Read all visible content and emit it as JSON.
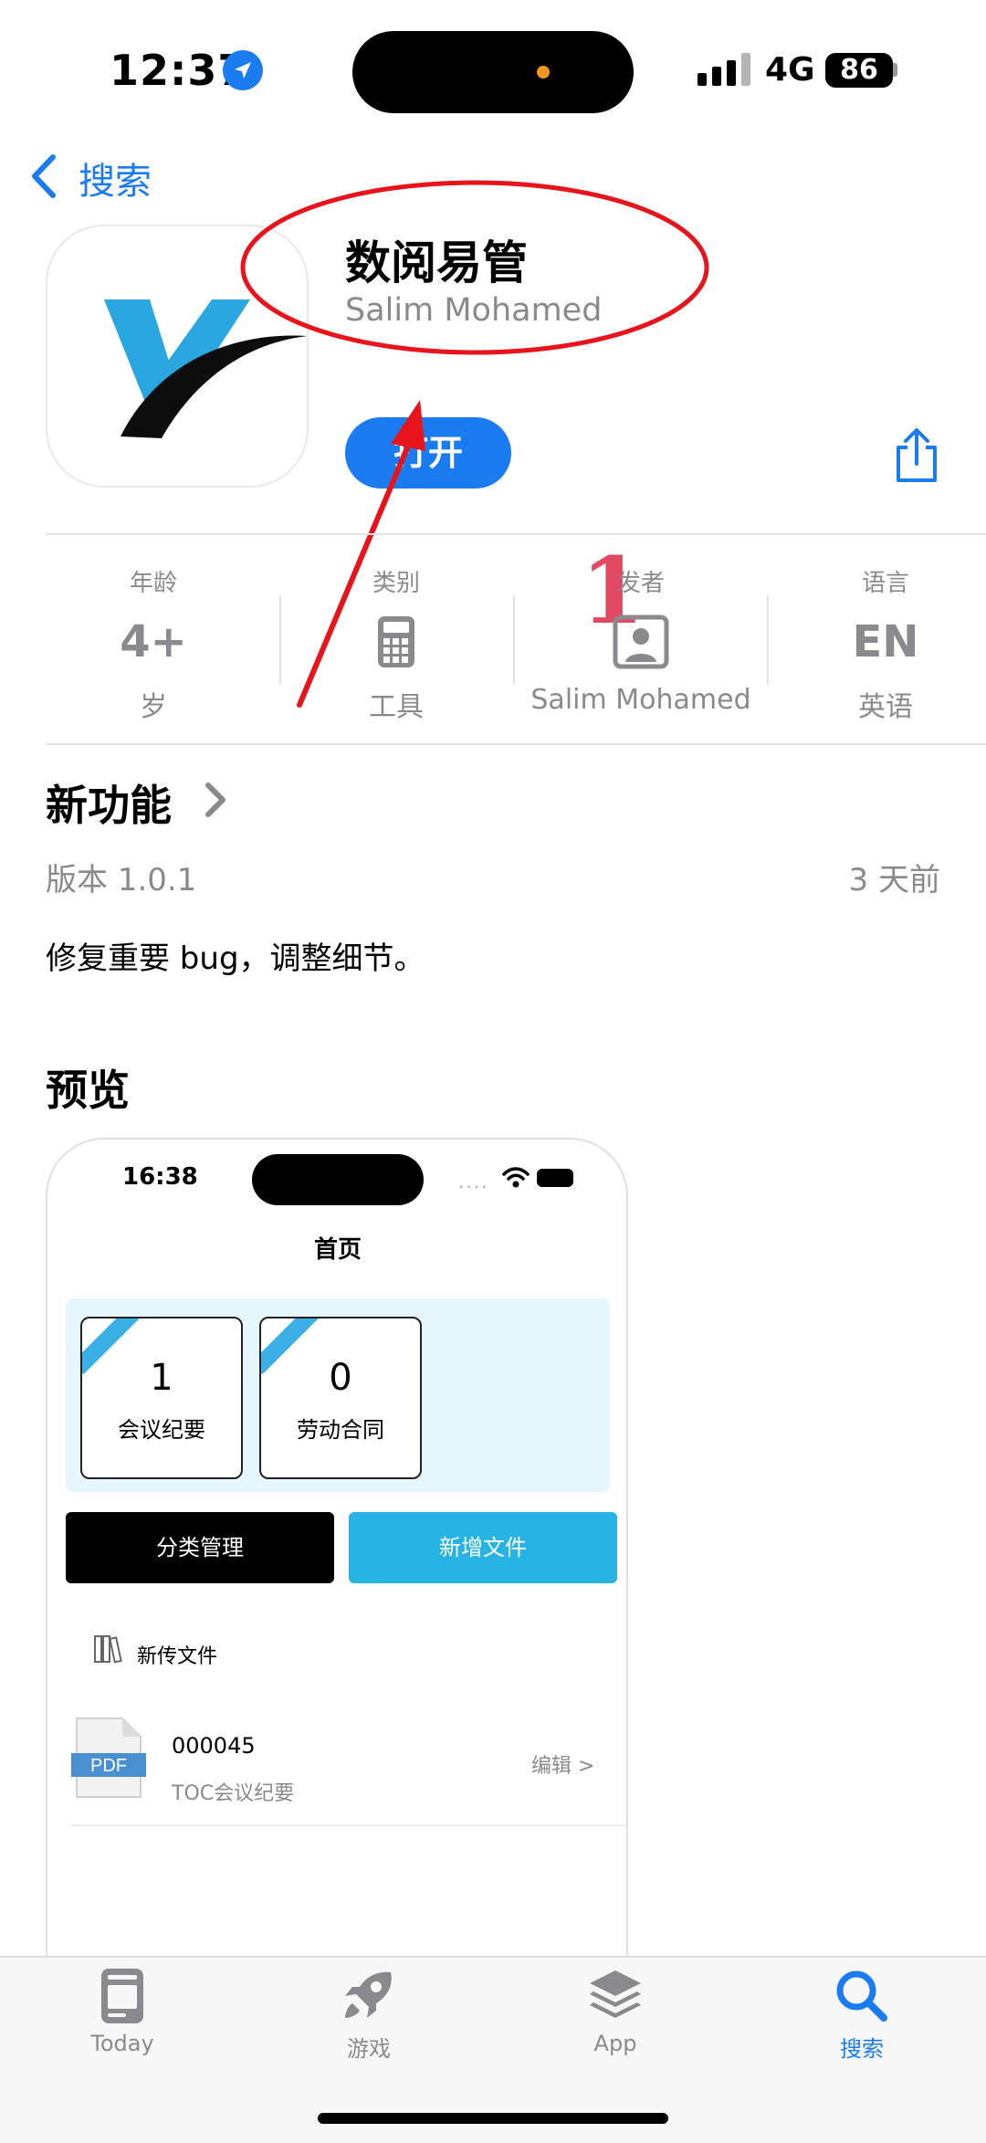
{
  "status_bar": {
    "time": "12:37",
    "network": "4G",
    "battery": "86"
  },
  "nav": {
    "back_label": "搜索"
  },
  "app": {
    "name": "数阅易管",
    "developer": "Salim Mohamed",
    "open_label": "打开"
  },
  "annotation": {
    "number": "1"
  },
  "info": {
    "age": {
      "label": "年龄",
      "value": "4+",
      "sub": "岁"
    },
    "category": {
      "label": "类别",
      "sub": "工具"
    },
    "developer": {
      "label": "发者",
      "sub": "Salim Mohamed"
    },
    "language": {
      "label": "语言",
      "value": "EN",
      "sub": "英语"
    }
  },
  "whats_new": {
    "title": "新功能",
    "version": "版本 1.0.1",
    "time_ago": "3 天前",
    "notes": "修复重要 bug，调整细节。"
  },
  "preview": {
    "title": "预览",
    "screen": {
      "time": "16:38",
      "dots": "....",
      "page_title": "首页",
      "cards": [
        {
          "count": "1",
          "label": "会议纪要"
        },
        {
          "count": "0",
          "label": "劳动合同"
        }
      ],
      "btn_manage": "分类管理",
      "btn_add": "新增文件",
      "recent_label": "新传文件",
      "doc": {
        "badge": "PDF",
        "number": "000045",
        "category": "TOC会议纪要",
        "edit": "编辑 >"
      }
    }
  },
  "tabs": [
    {
      "label": "Today",
      "icon": "today-icon"
    },
    {
      "label": "游戏",
      "icon": "rocket-icon"
    },
    {
      "label": "App",
      "icon": "layers-icon"
    },
    {
      "label": "搜索",
      "icon": "search-icon",
      "active": true
    }
  ],
  "colors": {
    "accent": "#1a7cf0",
    "annotation_red": "#e8141c",
    "number_pink": "#e24a63"
  }
}
